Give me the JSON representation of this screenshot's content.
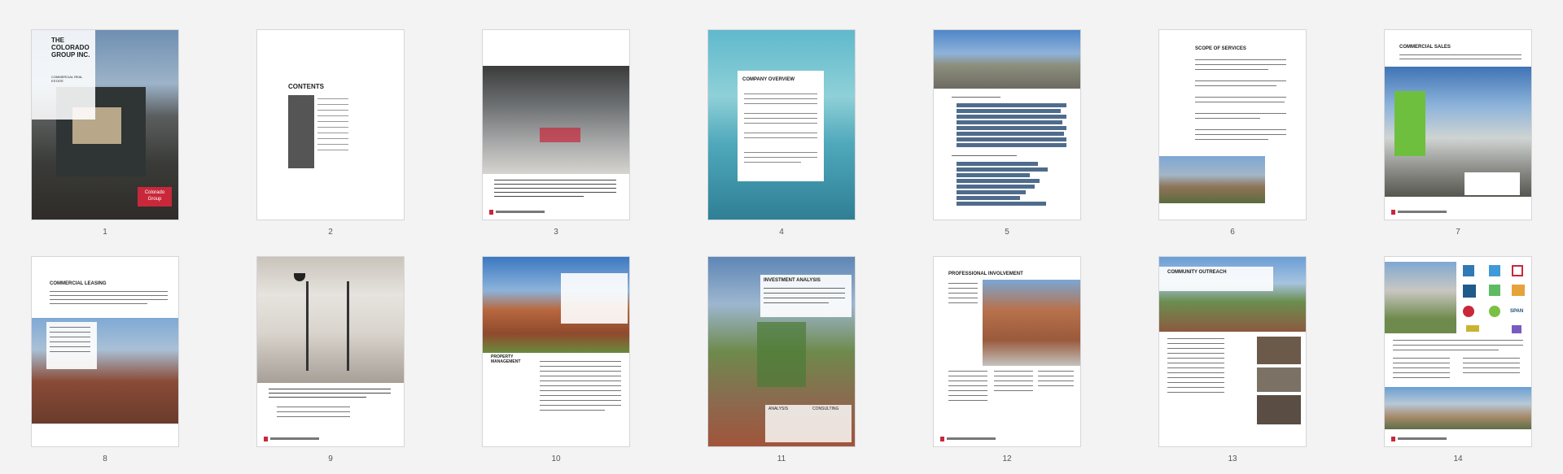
{
  "pages": [
    {
      "num": "1",
      "title": "THE COLORADO GROUP INC.",
      "subtitle": "COMMERCIAL REAL ESTATE",
      "logo": "Colorado Group"
    },
    {
      "num": "2",
      "title": "CONTENTS"
    },
    {
      "num": "3"
    },
    {
      "num": "4",
      "title": "COMPANY OVERVIEW"
    },
    {
      "num": "5"
    },
    {
      "num": "6",
      "title": "SCOPE OF SERVICES"
    },
    {
      "num": "7",
      "title": "COMMERCIAL SALES"
    },
    {
      "num": "8",
      "title": "COMMERCIAL LEASING"
    },
    {
      "num": "9"
    },
    {
      "num": "10",
      "title": "PROPERTY MANAGEMENT"
    },
    {
      "num": "11",
      "title": "INVESTMENT ANALYSIS",
      "label_a": "ANALYSIS",
      "label_b": "CONSULTING"
    },
    {
      "num": "12",
      "title": "PROFESSIONAL INVOLVEMENT"
    },
    {
      "num": "13",
      "title": "COMMUNITY OUTREACH"
    },
    {
      "num": "14",
      "logo_a": "SPAN"
    }
  ],
  "colors": {
    "brand_red": "#c8283a",
    "bar_blue": "#4f6c8c",
    "background": "#f3f3f4"
  }
}
